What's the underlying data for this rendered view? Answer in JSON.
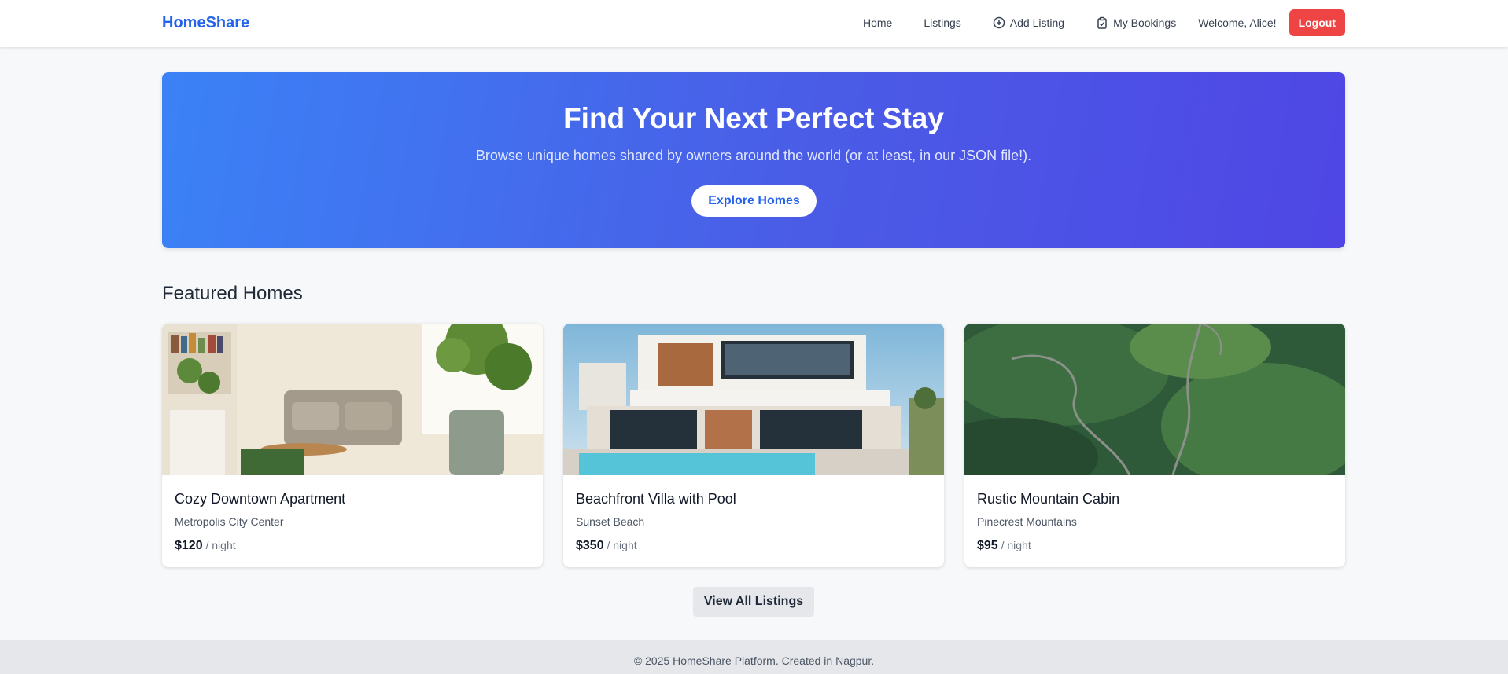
{
  "navbar": {
    "brand": "HomeShare",
    "links": [
      {
        "label": "Home",
        "icon": null
      },
      {
        "label": "Listings",
        "icon": null
      },
      {
        "label": "Add Listing",
        "icon": "plus-circle-icon"
      },
      {
        "label": "My Bookings",
        "icon": "clipboard-check-icon"
      }
    ],
    "welcome": "Welcome, Alice!",
    "logout_label": "Logout"
  },
  "hero": {
    "title": "Find Your Next Perfect Stay",
    "subtitle": "Browse unique homes shared by owners around the world (or at least, in our JSON file!).",
    "button_label": "Explore Homes"
  },
  "featured": {
    "title": "Featured Homes",
    "cards": [
      {
        "title": "Cozy Downtown Apartment",
        "location": "Metropolis City Center",
        "price": "$120",
        "unit": "/ night",
        "image": "living-room-photo"
      },
      {
        "title": "Beachfront Villa with Pool",
        "location": "Sunset Beach",
        "price": "$350",
        "unit": "/ night",
        "image": "villa-pool-photo"
      },
      {
        "title": "Rustic Mountain Cabin",
        "location": "Pinecrest Mountains",
        "price": "$95",
        "unit": "/ night",
        "image": "mountain-road-photo"
      }
    ],
    "view_all_label": "View All Listings"
  },
  "footer": {
    "text": "© 2025 HomeShare Platform. Created in Nagpur."
  },
  "colors": {
    "brand": "#2563eb",
    "logout": "#ef4444",
    "hero_start": "#3b82f6",
    "hero_end": "#4f46e5"
  }
}
